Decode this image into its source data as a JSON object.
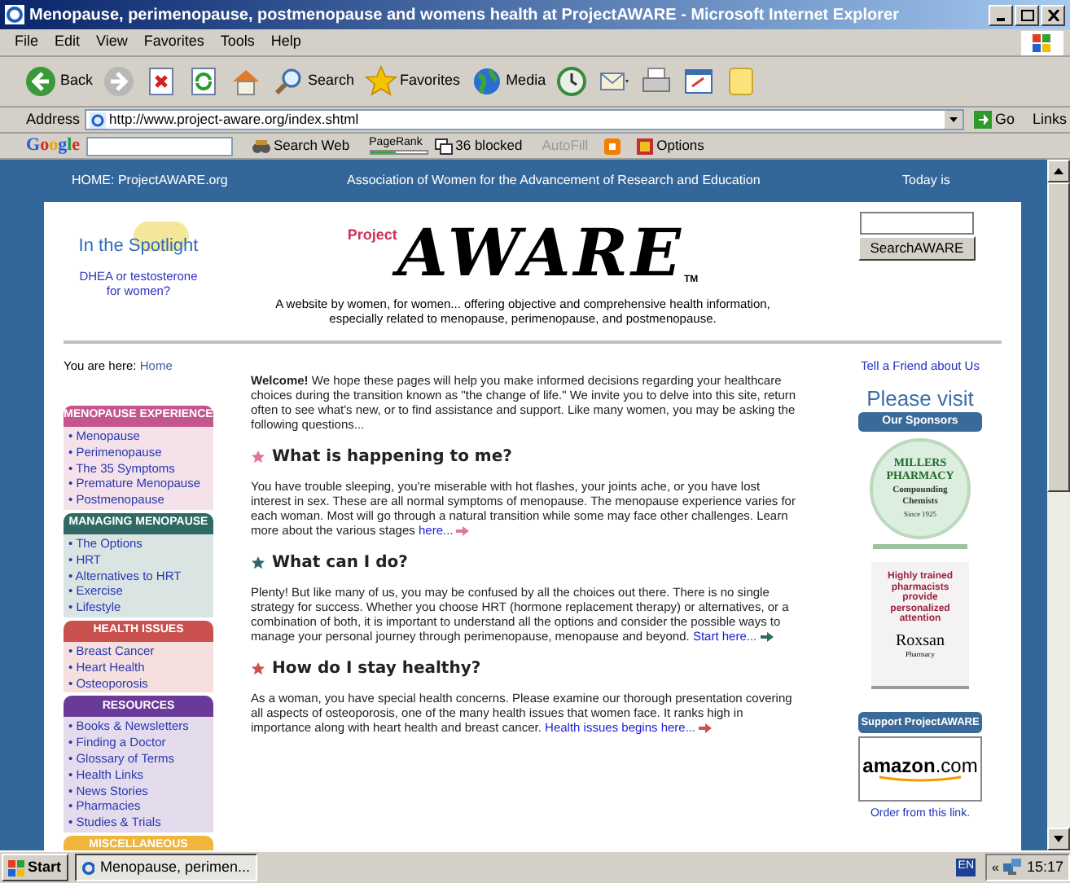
{
  "window": {
    "title": "Menopause, perimenopause, postmenopause and womens health at ProjectAWARE - Microsoft Internet Explorer"
  },
  "menu": [
    "File",
    "Edit",
    "View",
    "Favorites",
    "Tools",
    "Help"
  ],
  "toolbar": [
    {
      "kind": "back",
      "label": "Back"
    },
    {
      "kind": "forward"
    },
    {
      "kind": "stop"
    },
    {
      "kind": "refresh"
    },
    {
      "kind": "home"
    },
    {
      "kind": "search",
      "label": "Search"
    },
    {
      "kind": "favorites",
      "label": "Favorites"
    },
    {
      "kind": "media",
      "label": "Media"
    },
    {
      "kind": "history"
    },
    {
      "kind": "mail"
    },
    {
      "kind": "print"
    },
    {
      "kind": "edit"
    },
    {
      "kind": "notes"
    }
  ],
  "address": {
    "label": "Address",
    "value": "http://www.project-aware.org/index.shtml",
    "go": "Go",
    "links": "Links"
  },
  "google_toolbar": {
    "brand": "Google",
    "search_web": "Search Web",
    "pagerank": "PageRank",
    "level": 0.45,
    "blocked": "36 blocked",
    "autofill": {
      "label": "AutoFill",
      "disabled": true
    },
    "options": "Options"
  },
  "page_header": {
    "home": "HOME: ProjectAWARE.org",
    "association": "Association of Women for the Advancement of Research and Education",
    "today": "Today is"
  },
  "spotlight": {
    "title": "In the Spotlight",
    "text": "DHEA or testosterone for women?"
  },
  "logo": {
    "project": "Project",
    "aware": "AWARE",
    "tm": "TM"
  },
  "tagline": "A website by women, for women... offering objective and comprehensive health information, especially related to menopause, perimenopause, and postmenopause.",
  "search": {
    "button": "SearchAWARE"
  },
  "breadcrumb": {
    "label": "You are here:",
    "link": "Home"
  },
  "nav": [
    {
      "title": "MENOPAUSE EXPERIENCE",
      "color": "#c4568c",
      "items": [
        "• Menopause",
        "• Perimenopause",
        "• The 35 Symptoms",
        "• Premature Menopause",
        "• Postmenopause"
      ]
    },
    {
      "title": "MANAGING MENOPAUSE",
      "color": "#2f6a66",
      "items": [
        "• The Options",
        "• HRT",
        "• Alternatives to HRT",
        "• Exercise",
        "• Lifestyle"
      ]
    },
    {
      "title": "HEALTH ISSUES",
      "color": "#c9504c",
      "items": [
        "• Breast Cancer",
        "• Heart Health",
        "• Osteoporosis"
      ]
    },
    {
      "title": "RESOURCES",
      "color": "#6a3a98",
      "items": [
        "• Books & Newsletters",
        "• Finding a Doctor",
        "• Glossary of Terms",
        "• Health Links",
        "• News Stories",
        "• Pharmacies",
        "• Studies & Trials"
      ]
    },
    {
      "title": "MISCELLANEOUS",
      "color": "#f2b53c"
    }
  ],
  "welcome": "**Welcome!** We hope these pages will help you make informed decisions regarding your healthcare choices during the transition known as \"the change of life.\" We invite you to delve into this site, return often to see what's new, or to find assistance and support. Like many women, you may be asking the following questions...",
  "questions": [
    {
      "heading": "What is happening to me?",
      "color": "#e0749e",
      "text": "You have trouble sleeping, you're miserable with hot flashes, your joints ache, or you have lost interest in sex. These are all normal symptoms of menopause. The menopause experience varies for each woman. Most will go through a natural transition while some may face other challenges. Learn more about the various stages",
      "link": "here..."
    },
    {
      "heading": "What can I do?",
      "color": "#2f6a66",
      "text": "Plenty! But like many of us, you may be confused by all the choices out there. There is no single strategy for success. Whether you choose HRT (hormone replacement therapy) or alternatives, or a combination of both, it is important to understand all the options and consider the possible ways to manage your personal journey through perimenopause, menopause and beyond.",
      "link": "Start here..."
    },
    {
      "heading": "How do I stay healthy?",
      "color": "#d0504c",
      "text": "As a woman, you have special health concerns. Please examine our thorough presentation covering all aspects of osteoporosis, one of the many health issues that women face. It ranks high in importance along with heart health and breast cancer.",
      "link": "Health issues begins here..."
    }
  ],
  "right": {
    "tell_friend": "Tell a Friend about Us",
    "please_visit": "Please visit",
    "sponsors": "Our Sponsors",
    "millers": {
      "name": "MILLERS PHARMACY",
      "tagline": "Compounding Chemists",
      "since": "Since 1925"
    },
    "roxsan": {
      "text": "Highly trained pharmacists provide personalized attention",
      "brand": "Roxsan",
      "sub": "Pharmacy"
    },
    "support": "Support ProjectAWARE",
    "amazon": "**amazon**.com",
    "order": "Order from this link."
  },
  "taskbar": {
    "start": "Start",
    "task": "Menopause, perimen...",
    "lang": "EN",
    "chevron": "«",
    "clock": "15:17"
  }
}
